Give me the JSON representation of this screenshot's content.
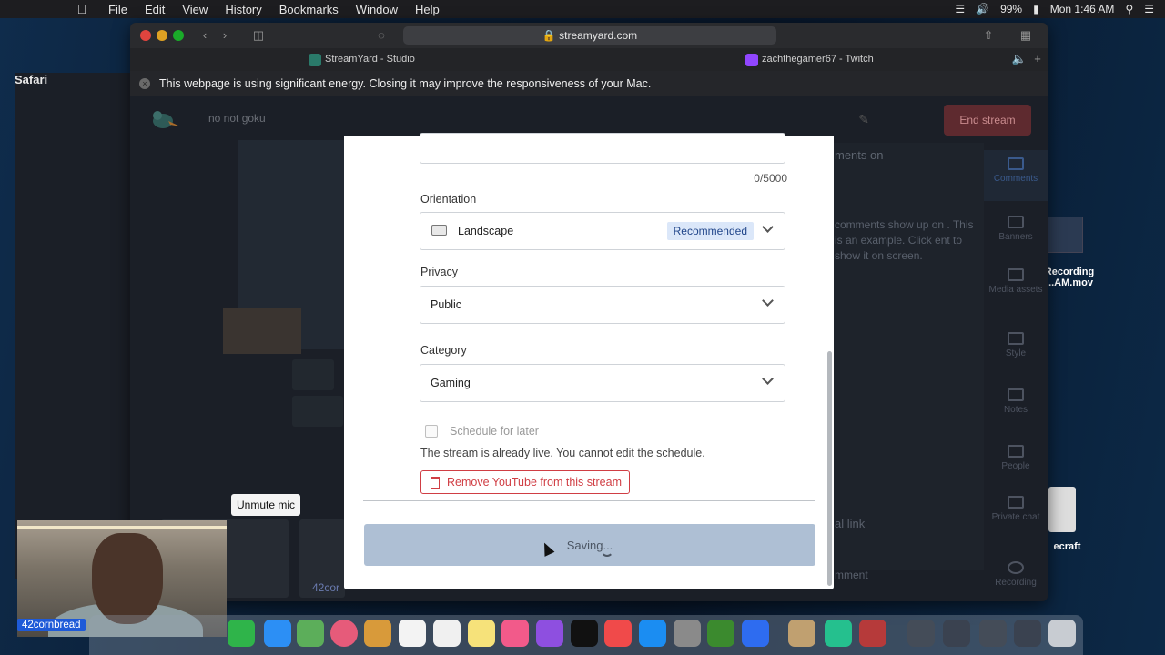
{
  "menubar": {
    "app": "Safari",
    "items": [
      "File",
      "Edit",
      "View",
      "History",
      "Bookmarks",
      "Window",
      "Help"
    ],
    "battery": "99%",
    "clock": "Mon 1:46 AM"
  },
  "browser": {
    "address": "streamyard.com",
    "tabs": [
      {
        "title": "StreamYard - Studio"
      },
      {
        "title": "zachthegamer67 - Twitch"
      }
    ],
    "banner": "This webpage is using significant energy. Closing it may improve the responsiveness of your Mac."
  },
  "studio": {
    "username": "no not goku",
    "end_stream": "End stream",
    "tooltip": "Unmute mic",
    "participant_name": "42cornbread",
    "participant_name_2": "42cor",
    "side_title": "ments on",
    "side_text": "comments show up on . This is an example. Click ent to show it on screen.",
    "side_link": "al link",
    "side_comment": "mment",
    "rail": [
      "Comments",
      "Banners",
      "Media assets",
      "Style",
      "Notes",
      "People",
      "Private chat",
      "Recording"
    ]
  },
  "modal": {
    "description_counter": "0/5000",
    "orientation": {
      "label": "Orientation",
      "value": "Landscape",
      "badge": "Recommended"
    },
    "privacy": {
      "label": "Privacy",
      "value": "Public"
    },
    "category": {
      "label": "Category",
      "value": "Gaming"
    },
    "schedule_label": "Schedule for later",
    "schedule_note": "The stream is already live. You cannot edit the schedule.",
    "remove_button": "Remove YouTube from this stream",
    "saving_label": "Saving..."
  },
  "desktop": {
    "file1": "Recording",
    "file1_b": "...AM.mov",
    "file2": "ecraft"
  },
  "webcam_label": "42cornbread"
}
